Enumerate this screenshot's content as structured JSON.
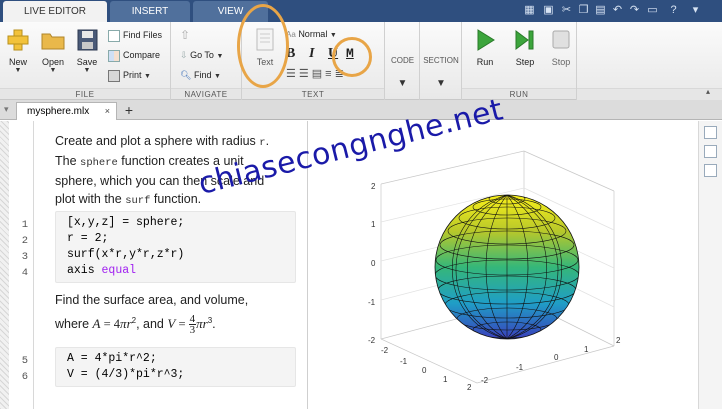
{
  "tabs": {
    "live_editor": "LIVE EDITOR",
    "insert": "INSERT",
    "view": "VIEW"
  },
  "ribbon": {
    "file": {
      "group_label": "FILE",
      "new": "New",
      "open": "Open",
      "save": "Save",
      "find_files": "Find Files",
      "compare": "Compare",
      "print": "Print"
    },
    "navigate": {
      "group_label": "NAVIGATE",
      "go_to": "Go To",
      "find": "Find"
    },
    "text": {
      "group_label": "TEXT",
      "text_button": "Text",
      "style_select": "Normal",
      "bold": "B",
      "italic": "I",
      "underline": "U",
      "monospace": "M"
    },
    "code": {
      "group_label": "CODE"
    },
    "section": {
      "group_label": "SECTION"
    },
    "run": {
      "group_label": "RUN",
      "run": "Run",
      "step": "Step",
      "stop": "Stop"
    }
  },
  "doc_tab": {
    "filename": "mysphere.mlx",
    "close": "×",
    "add": "+"
  },
  "editor": {
    "para1": {
      "l1a": "Create and plot a sphere with radius ",
      "l1b": "r",
      "l1c": ".",
      "l2a": "The ",
      "l2b": "sphere",
      "l2c": " function creates a unit",
      "l3": "sphere, which you can then scale and",
      "l4a": "plot with the ",
      "l4b": "surf",
      "l4c": " function."
    },
    "code1": {
      "line_numbers": [
        "1",
        "2",
        "3",
        "4"
      ],
      "lines": [
        "[x,y,z] = sphere;",
        "r = 2;",
        "surf(x*r,y*r,z*r)"
      ],
      "line4_cmd": "axis ",
      "line4_arg": "equal"
    },
    "para2": {
      "l1": "Find the surface area, and volume,",
      "where": "where ",
      "A": "A",
      "eq1": " = 4",
      "pi1": "π",
      "r1": "r",
      "sup2": "2",
      "comma": ", and ",
      "V": "V",
      "eq2": " = ",
      "num": "4",
      "den": "3",
      "pi2": "π",
      "r2": "r",
      "sup3": "3",
      "dot": "."
    },
    "code2": {
      "line_numbers": [
        "5",
        "6"
      ],
      "lines": [
        "A = 4*pi*r^2;",
        "V = (4/3)*pi*r^3;"
      ]
    }
  },
  "figure": {
    "z_ticks": [
      "2",
      "1",
      "0",
      "-1",
      "-2"
    ],
    "x_ticks": [
      "-2",
      "-1",
      "0",
      "1",
      "2"
    ],
    "y_ticks": [
      "2",
      "1",
      "0",
      "-1",
      "-2"
    ]
  },
  "watermark": "chiasecongnghe.net",
  "colors": {
    "title_bar": "#2f4f7f",
    "highlight_circle": "#e8a547",
    "watermark": "#1a1aa8",
    "keyword": "#a020f0"
  }
}
